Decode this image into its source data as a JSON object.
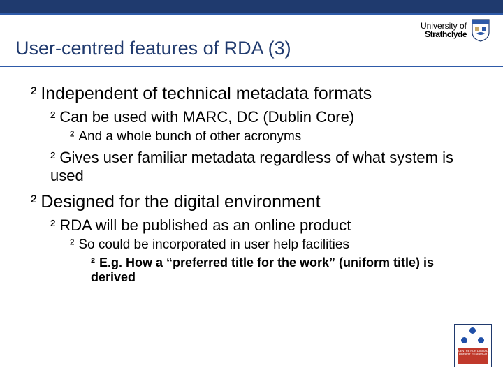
{
  "logo": {
    "line1": "University of",
    "line2": "Strathclyde"
  },
  "title": "User-centred features of RDA (3)",
  "bullets": {
    "p1": "Independent of technical metadata formats",
    "p1a": "Can be used with MARC, DC (Dublin Core)",
    "p1a1": "And a whole bunch of other acronyms",
    "p1b": "Gives user familiar metadata regardless of what system is used",
    "p2": "Designed for the digital environment",
    "p2a": "RDA will be published as an online product",
    "p2a1": "So could be incorporated in user help facilities",
    "p2a1a": "E.g. How a “preferred title for the work” (uniform title) is derived"
  },
  "footer": {
    "text": "CENTRE FOR DIGITAL LIBRARY RESEARCH"
  }
}
